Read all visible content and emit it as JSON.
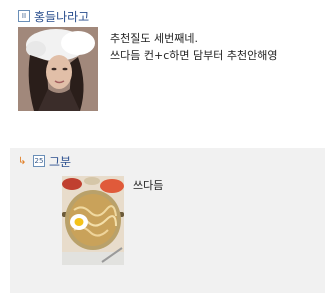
{
  "comment": {
    "badge": "II",
    "author": "홍들나라고",
    "lines": [
      "추천질도 세번째네.",
      "쓰다듬 컨+c하면 담부터 추천안해영"
    ]
  },
  "reply": {
    "badge": "25",
    "author": "그분",
    "text": "쓰다듬"
  }
}
